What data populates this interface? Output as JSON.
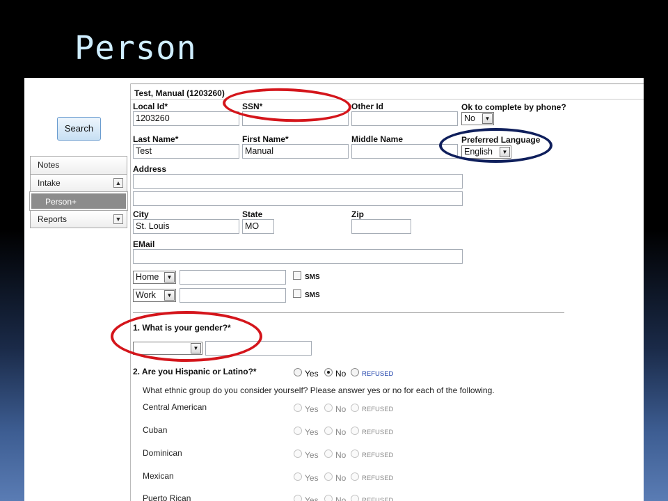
{
  "slide": {
    "title": "Person"
  },
  "sidebar": {
    "search_label": "Search",
    "items": [
      {
        "label": "Notes"
      },
      {
        "label": "Intake",
        "caret": "▲"
      },
      {
        "label": "Person+"
      },
      {
        "label": "Reports",
        "caret": "▼"
      }
    ]
  },
  "record": {
    "title": "Test, Manual (1203260)"
  },
  "fields": {
    "local_id": {
      "label": "Local Id*",
      "value": "1203260"
    },
    "ssn": {
      "label": "SSN*",
      "value": ""
    },
    "other_id": {
      "label": "Other Id",
      "value": ""
    },
    "phone_ok": {
      "label": "Ok to complete by phone?",
      "value": "No"
    },
    "last_name": {
      "label": "Last Name*",
      "value": "Test"
    },
    "first_name": {
      "label": "First Name*",
      "value": "Manual"
    },
    "middle_name": {
      "label": "Middle Name",
      "value": ""
    },
    "preferred_language": {
      "label": "Preferred Language",
      "value": "English"
    },
    "address": {
      "label": "Address",
      "line1": "",
      "line2": ""
    },
    "city": {
      "label": "City",
      "value": "St. Louis"
    },
    "state": {
      "label": "State",
      "value": "MO"
    },
    "zip": {
      "label": "Zip",
      "value": ""
    },
    "email": {
      "label": "EMail",
      "value": ""
    },
    "phones": [
      {
        "type": "Home",
        "number": "",
        "sms_label": "SMS"
      },
      {
        "type": "Work",
        "number": "",
        "sms_label": "SMS"
      }
    ]
  },
  "questions": {
    "gender": {
      "label": "1. What is your gender?*",
      "selected": "",
      "other": ""
    },
    "hispanic": {
      "label": "2. Are you Hispanic or Latino?*",
      "options": [
        "Yes",
        "No",
        "REFUSED"
      ],
      "selected": "No",
      "followup": "What ethnic group do you consider yourself? Please answer yes or no for each of the following.",
      "groups": [
        {
          "label": "Central American"
        },
        {
          "label": "Cuban"
        },
        {
          "label": "Dominican"
        },
        {
          "label": "Mexican"
        },
        {
          "label": "Puerto Rican"
        }
      ]
    }
  },
  "annotations": {
    "red_color": "#d4151b",
    "blue_color": "#0f1f5c"
  },
  "icons": {
    "dropdown": "▼",
    "collapse": "▲"
  }
}
